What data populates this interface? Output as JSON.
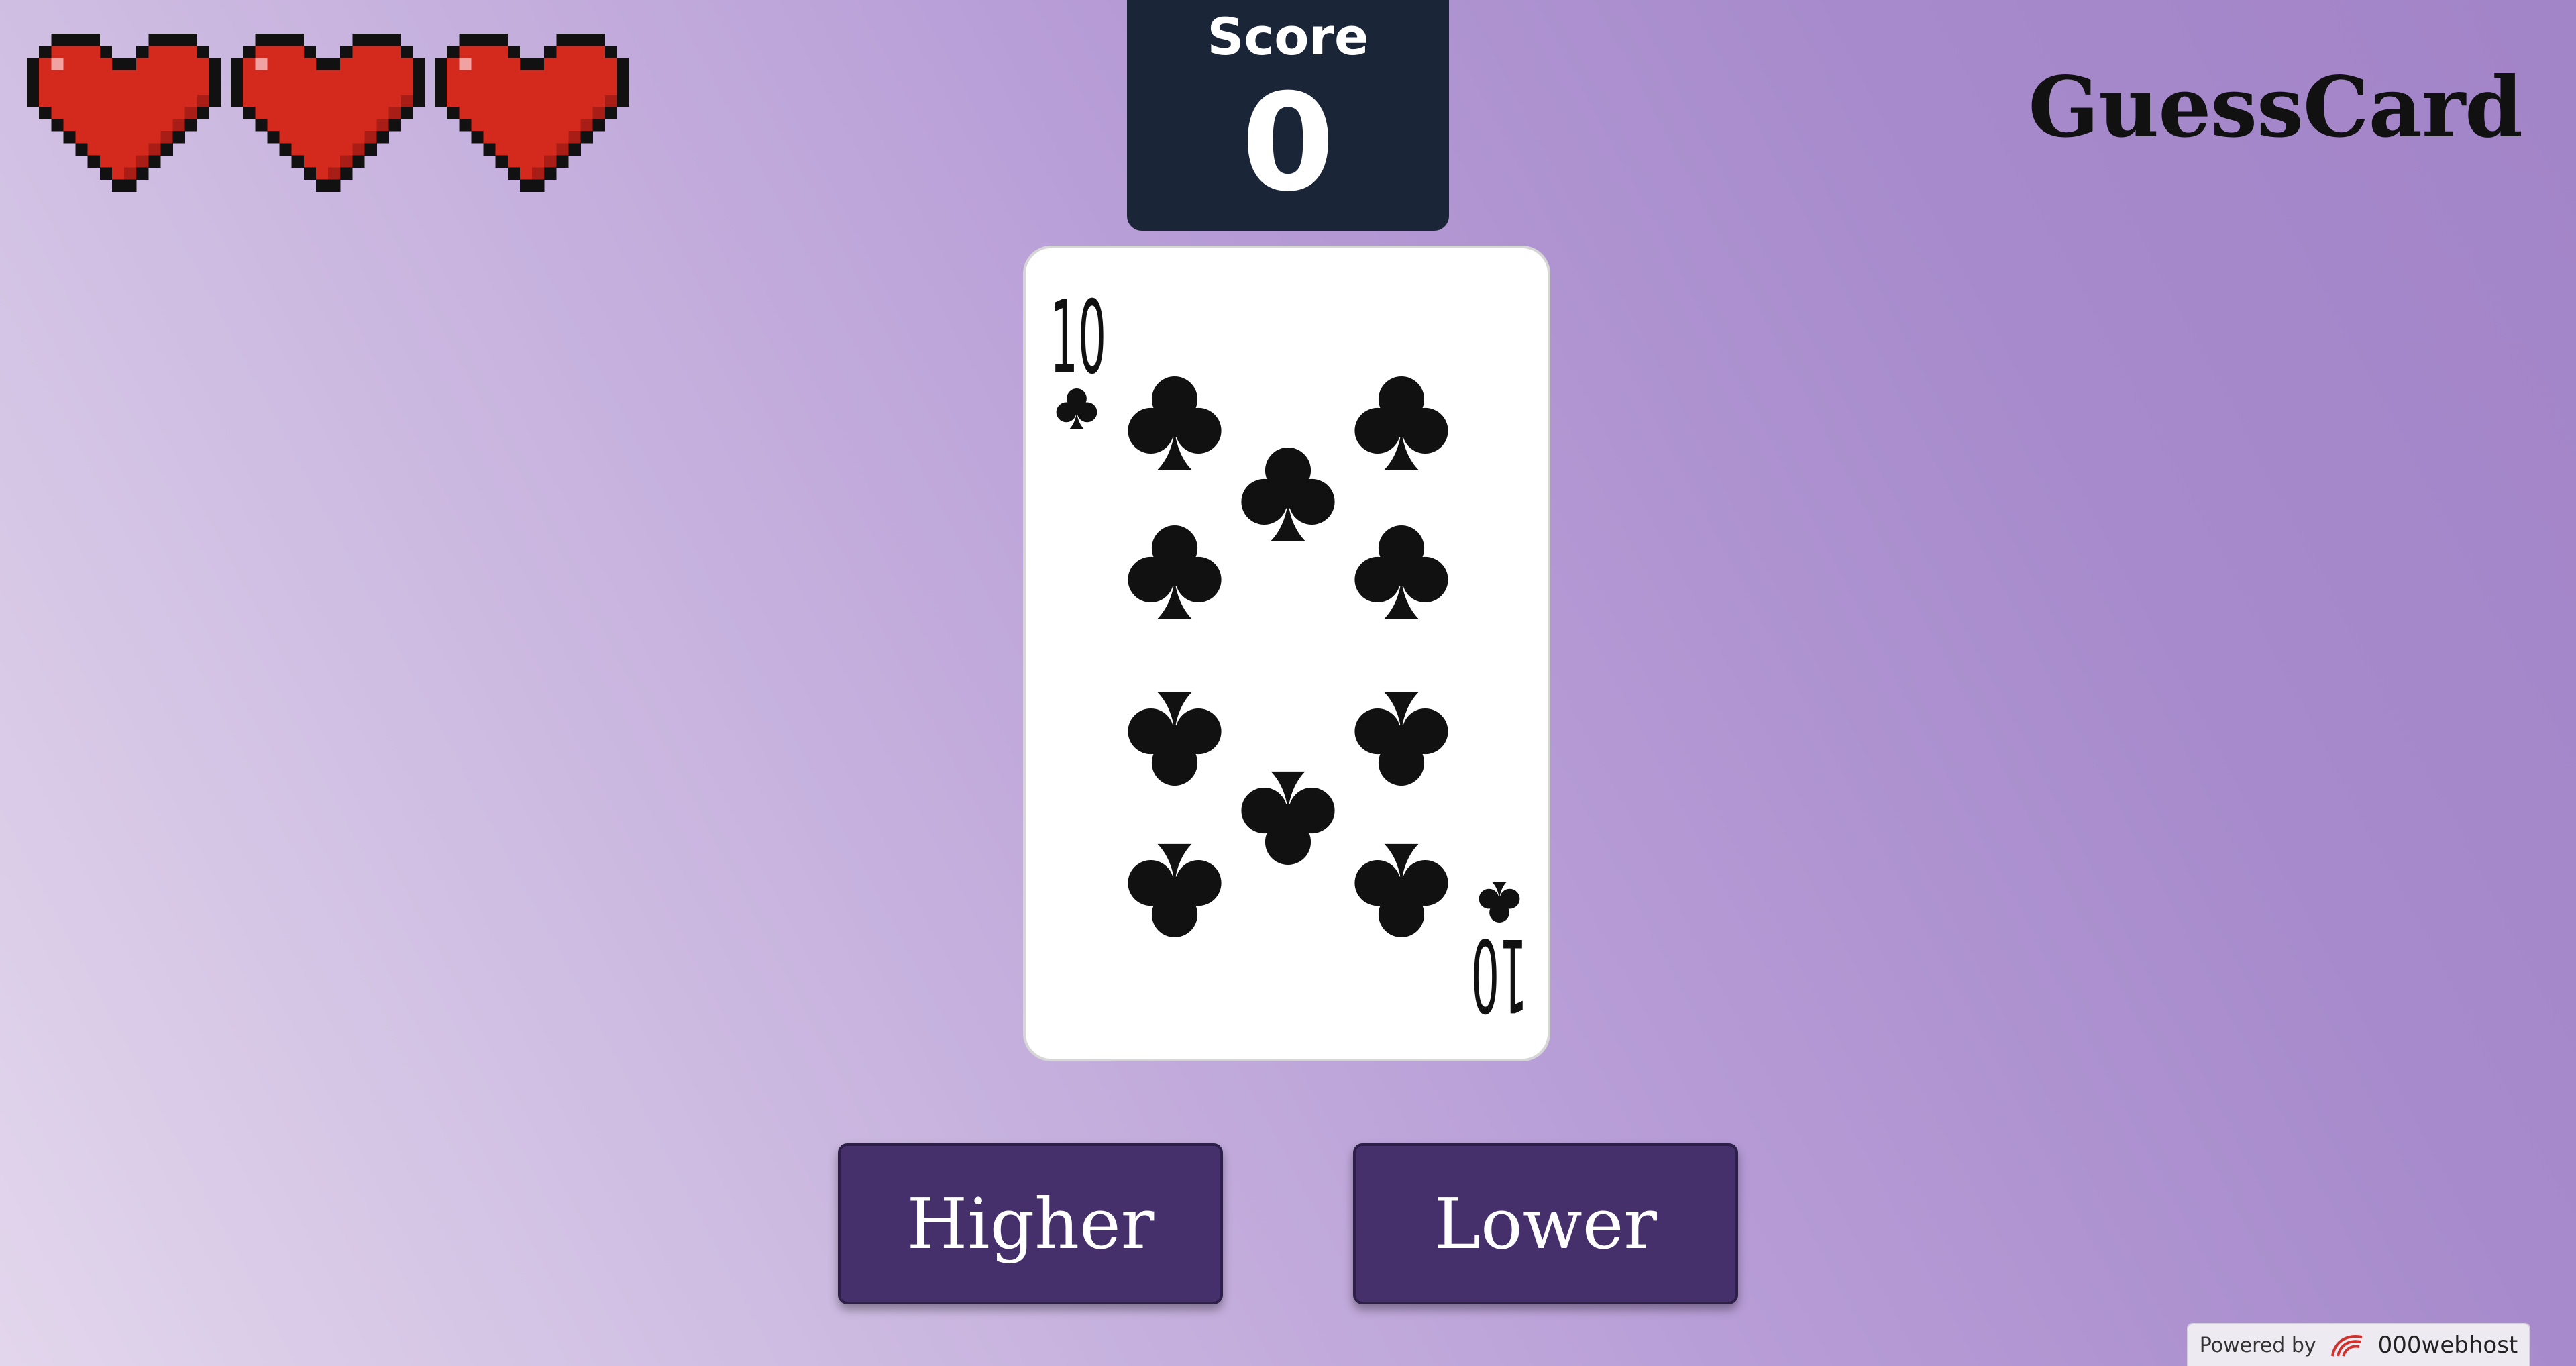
{
  "lives": {
    "count": 3,
    "icon": "pixel-heart-icon",
    "colors": {
      "fill": "#d42a1e",
      "shade": "#a81e17",
      "outline": "#111111",
      "highlight": "#f0a2a2"
    }
  },
  "score": {
    "label": "Score",
    "value": "0"
  },
  "brand": {
    "title": "GuessCard"
  },
  "card": {
    "rank": "10",
    "suit": "clubs",
    "suit_icon": "club-icon",
    "color": "#111111"
  },
  "actions": {
    "higher_label": "Higher",
    "lower_label": "Lower"
  },
  "footer": {
    "powered_label": "Powered by",
    "host_name": "000webhost",
    "host_icon": "000webhost-logo-icon"
  },
  "colors": {
    "score_panel": "#1b2538",
    "button": "#45306b",
    "card_bg": "#ffffff"
  }
}
